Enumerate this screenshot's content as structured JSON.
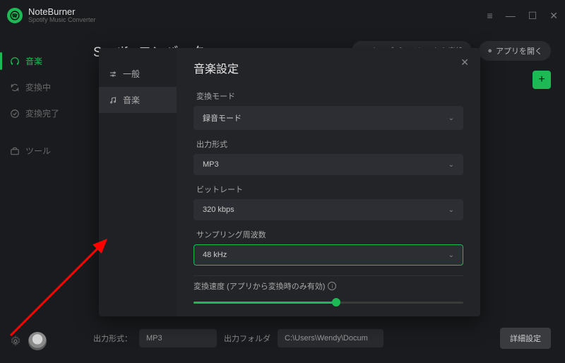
{
  "brand": {
    "name": "NoteBurner",
    "subtitle": "Spotify Music Converter"
  },
  "window_controls": {
    "menu": "≡",
    "min": "—",
    "max": "☐",
    "close": "✕"
  },
  "sidebar": {
    "items": [
      {
        "label": "音楽",
        "active": true
      },
      {
        "label": "変換中",
        "active": false
      },
      {
        "label": "変換完了",
        "active": false
      },
      {
        "label": "ツール",
        "active": false
      }
    ]
  },
  "page": {
    "title": "Spotify コンバーター",
    "webplayer_btn": "ウェブプレイヤーから変換",
    "open_app_btn": "アプリを開く"
  },
  "bottom": {
    "format_label": "出力形式：",
    "format_value": "MP3",
    "folder_label": "出力フォルダ",
    "folder_value": "C:\\Users\\Wendy\\Docum",
    "detail_btn": "詳細設定"
  },
  "modal": {
    "tabs": {
      "general": "一般",
      "music": "音楽"
    },
    "title": "音楽設定",
    "fields": {
      "mode": {
        "label": "変換モード",
        "value": "録音モード"
      },
      "format": {
        "label": "出力形式",
        "value": "MP3"
      },
      "bitrate": {
        "label": "ビットレート",
        "value": "320 kbps"
      },
      "samplerate": {
        "label": "サンプリング周波数",
        "value": "48 kHz"
      }
    },
    "speed": {
      "label": "変換速度 (アプリから変換時のみ有効)"
    }
  }
}
